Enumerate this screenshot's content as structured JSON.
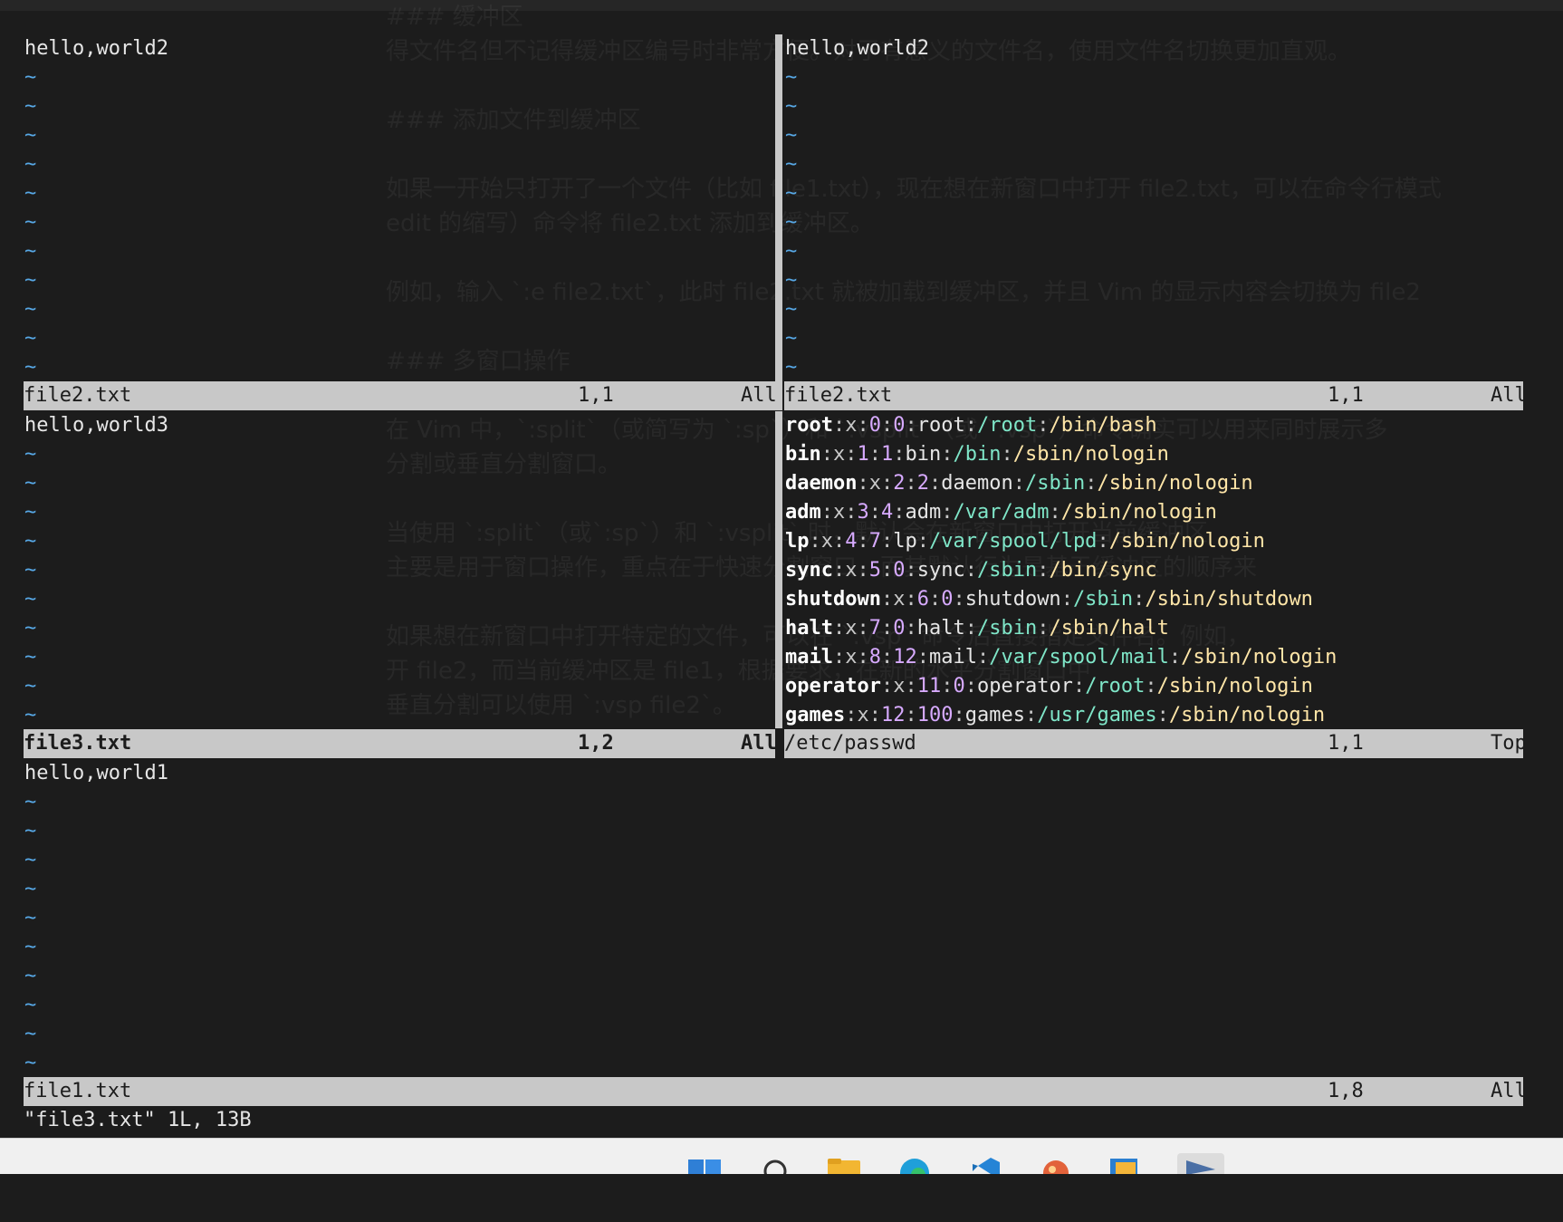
{
  "ghost_text": [
    "### 缓冲区",
    "得文件名但不记得缓冲区编号时非常方便。对于有意义的文件名，使用文件名切换更加直观。",
    "",
    "### 添加文件到缓冲区",
    "",
    "如果一开始只打开了一个文件（比如 file1.txt），现在想在新窗口中打开 file2.txt，可以在命令行模式",
    "edit 的缩写）命令将 file2.txt 添加到缓冲区。",
    "",
    "例如，输入 `:e file2.txt`，此时 file2.txt 就被加载到缓冲区，并且 Vim 的显示内容会切换为 file2",
    "",
    "### 多窗口操作",
    "",
    "在 Vim 中，`:split`（或简写为 `:sp`）和 `:vsplit`（或 `:vsp`）命令确实可以用来同时展示多",
    "分割或垂直分割窗口。",
    "",
    "当使用 `:split`（或`:sp`）和 `:vsplit` 时，默认会在新窗口中打开当前缓冲区",
    "主要是用于窗口操作，重点在于快速分割窗口，而其默认行为是基于缓冲区的顺序来",
    "",
    "如果想在新窗口中打开特定的文件，可以在 `:vsp` 命令后直接指定文件名。例如，",
    "开 file2，而当前缓冲区是 file1，根据要求，在新的水平分割窗口中",
    "垂直分割可以使用 `:vsp file2`。"
  ],
  "panes": {
    "top_left": {
      "content": "hello,world2",
      "tildes": 11,
      "status": {
        "filename": "file2.txt",
        "position": "1,1",
        "scroll": "All"
      }
    },
    "top_right": {
      "content": "hello,world2",
      "tildes": 11,
      "status": {
        "filename": "file2.txt",
        "position": "1,1",
        "scroll": "All"
      }
    },
    "mid_left": {
      "content": "hello,world3",
      "tildes": 10,
      "status": {
        "filename": "file3.txt",
        "position": "1,2",
        "scroll": "All"
      }
    },
    "mid_right": {
      "passwd_lines": [
        [
          "root",
          "x",
          "0",
          "0",
          "root",
          "/root",
          "/bin/bash"
        ],
        [
          "bin",
          "x",
          "1",
          "1",
          "bin",
          "/bin",
          "/sbin/nologin"
        ],
        [
          "daemon",
          "x",
          "2",
          "2",
          "daemon",
          "/sbin",
          "/sbin/nologin"
        ],
        [
          "adm",
          "x",
          "3",
          "4",
          "adm",
          "/var/adm",
          "/sbin/nologin"
        ],
        [
          "lp",
          "x",
          "4",
          "7",
          "lp",
          "/var/spool/lpd",
          "/sbin/nologin"
        ],
        [
          "sync",
          "x",
          "5",
          "0",
          "sync",
          "/sbin",
          "/bin/sync"
        ],
        [
          "shutdown",
          "x",
          "6",
          "0",
          "shutdown",
          "/sbin",
          "/sbin/shutdown"
        ],
        [
          "halt",
          "x",
          "7",
          "0",
          "halt",
          "/sbin",
          "/sbin/halt"
        ],
        [
          "mail",
          "x",
          "8",
          "12",
          "mail",
          "/var/spool/mail",
          "/sbin/nologin"
        ],
        [
          "operator",
          "x",
          "11",
          "0",
          "operator",
          "/root",
          "/sbin/nologin"
        ],
        [
          "games",
          "x",
          "12",
          "100",
          "games",
          "/usr/games",
          "/sbin/nologin"
        ]
      ],
      "status": {
        "filename": "/etc/passwd",
        "position": "1,1",
        "scroll": "Top"
      }
    },
    "bottom": {
      "content": "hello,world1",
      "tildes": 10,
      "status": {
        "filename": "file1.txt",
        "position": "1,8",
        "scroll": "All"
      }
    }
  },
  "tilde_char": "~",
  "command_line": "\"file3.txt\" 1L, 13B",
  "colors": {
    "background": "#1c1c1c",
    "statusline": "#c8c8c8",
    "tilde": "#57a8e6",
    "passwd_name": "#ffffff",
    "passwd_num": "#d7aaff",
    "passwd_home": "#7fe6c8",
    "passwd_shell": "#ffe6a8"
  },
  "taskbar": {
    "icons": [
      "windows-start-icon",
      "search-icon",
      "file-explorer-icon",
      "edge-browser-icon",
      "vscode-icon",
      "git-icon",
      "app-window-icon",
      "terminal-icon"
    ]
  }
}
